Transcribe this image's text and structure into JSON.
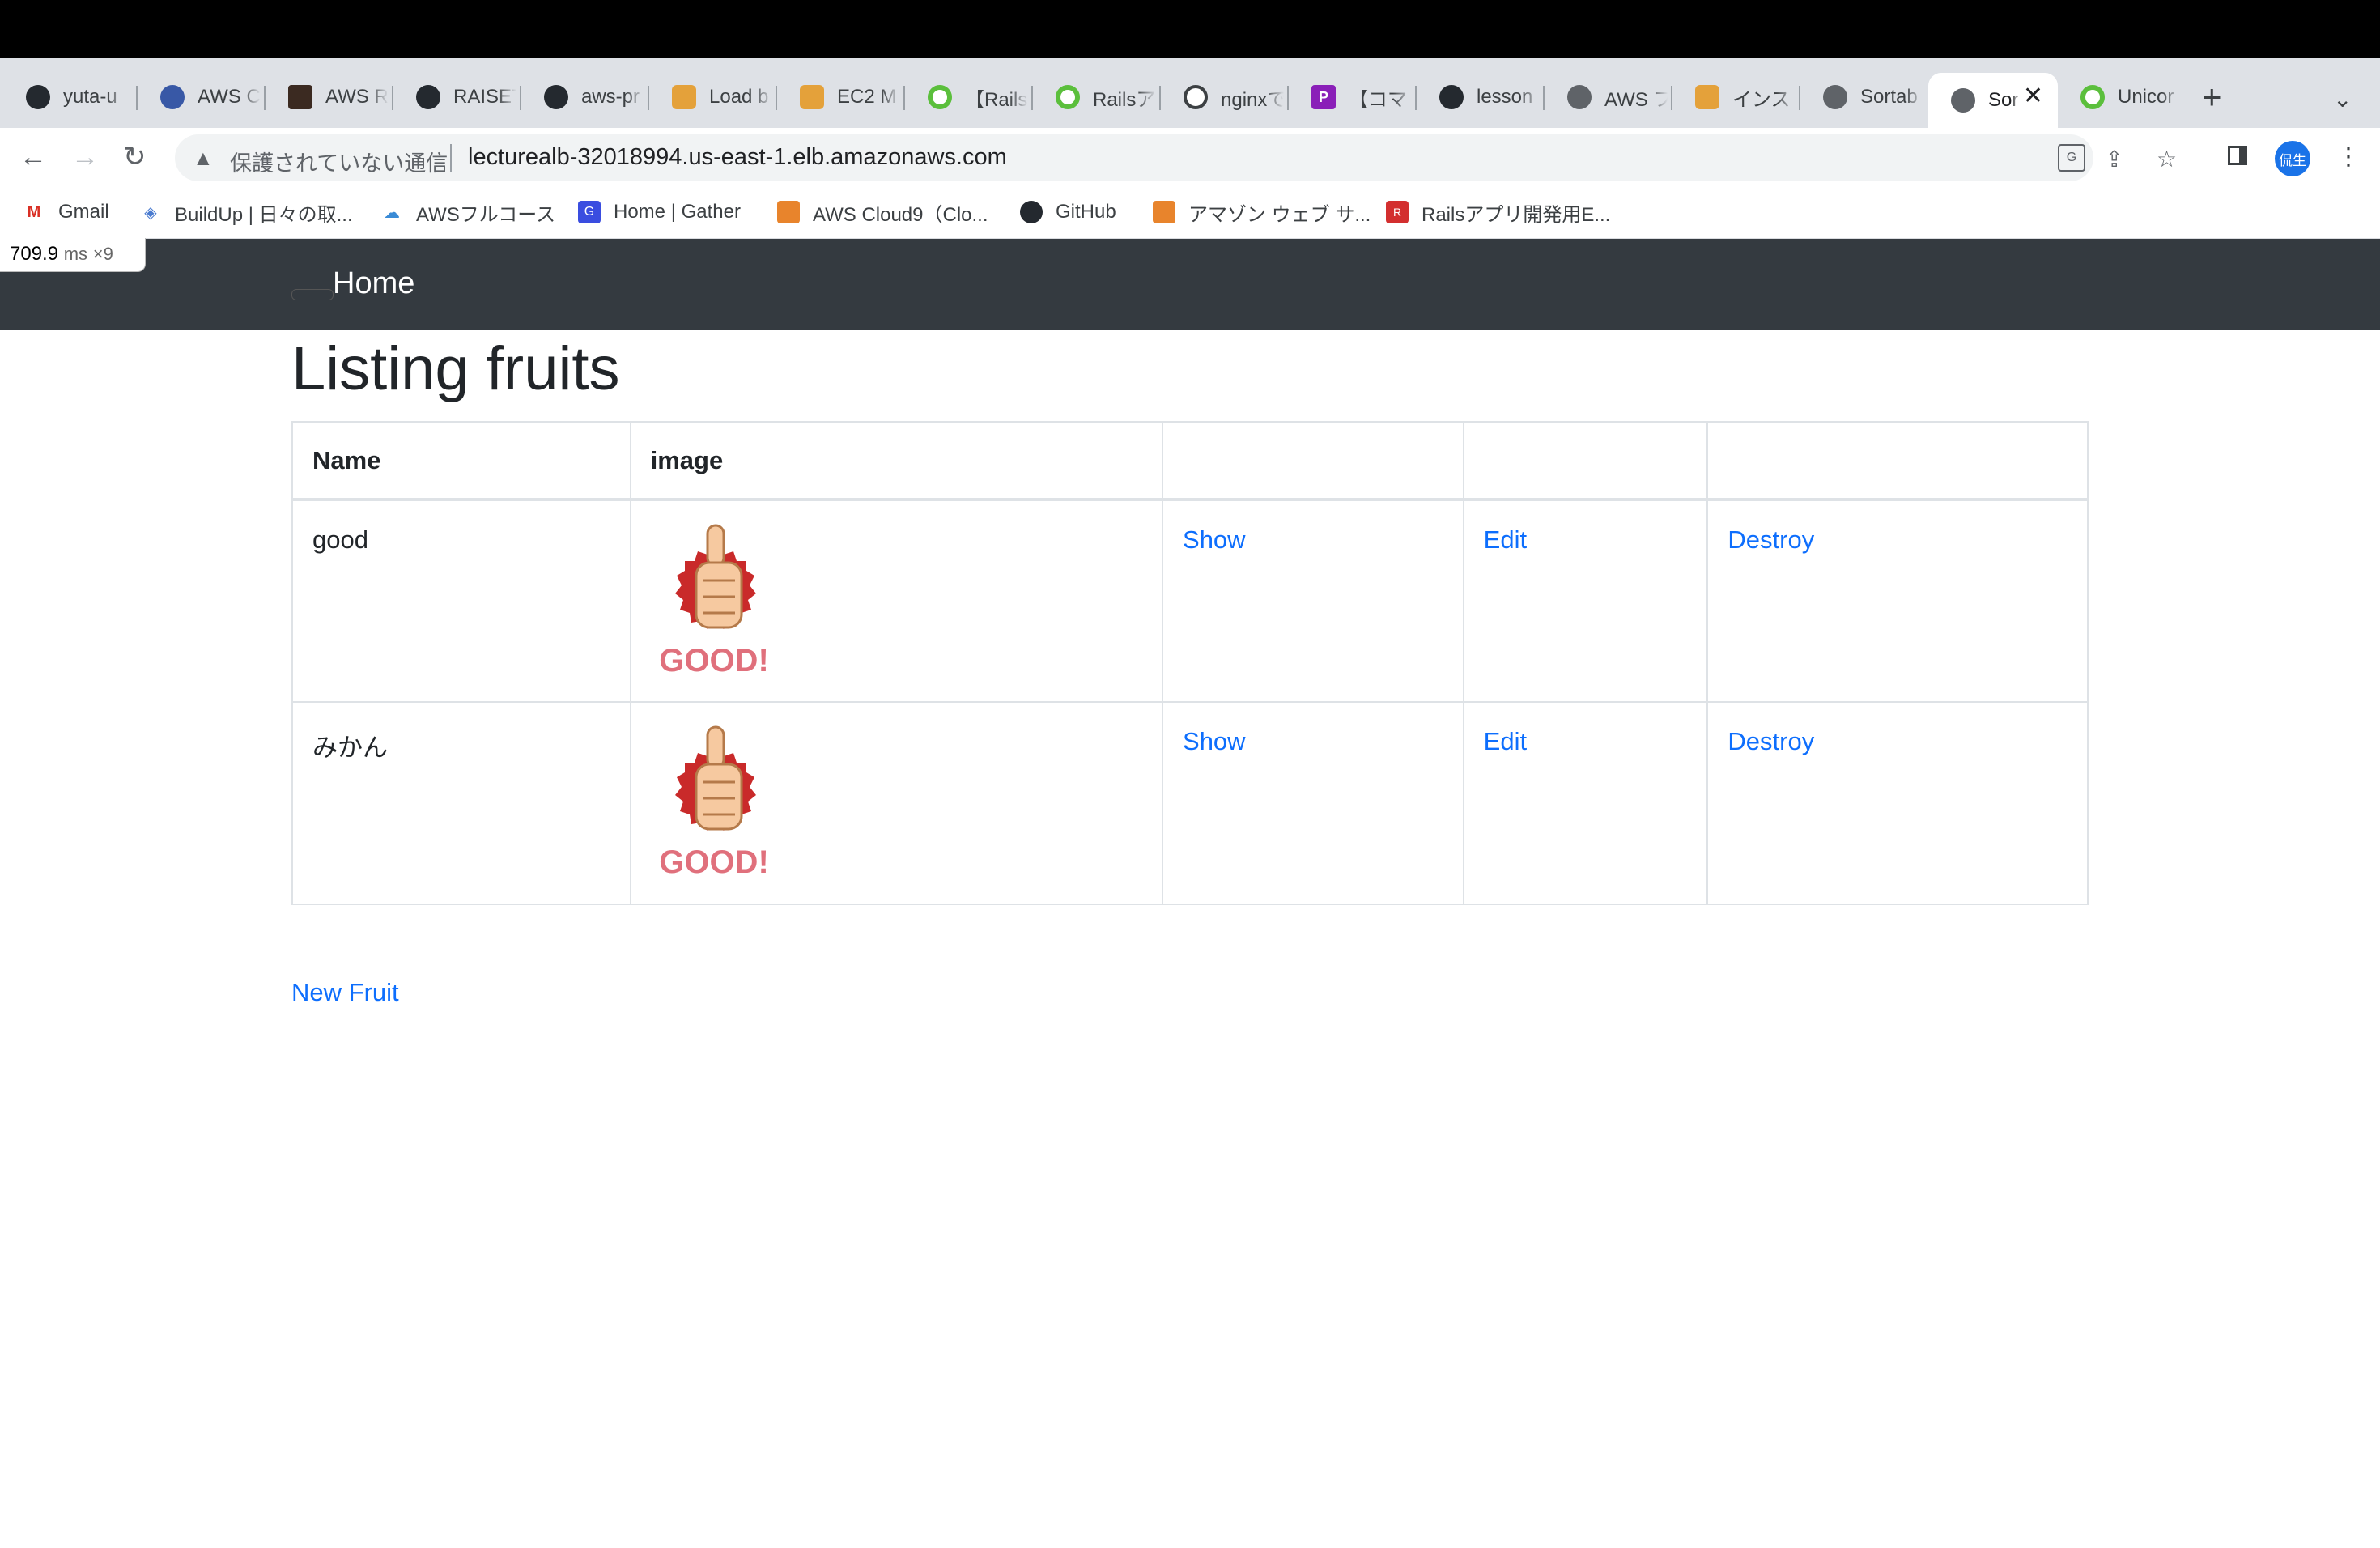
{
  "browser": {
    "tabs": [
      {
        "title": "yuta-u",
        "icon": "github-icon"
      },
      {
        "title": "AWS C",
        "icon": "wordpress-icon"
      },
      {
        "title": "AWS R",
        "icon": "photo-icon"
      },
      {
        "title": "RAISET",
        "icon": "github-icon"
      },
      {
        "title": "aws-pr",
        "icon": "github-icon"
      },
      {
        "title": "Load b",
        "icon": "aws-box-icon"
      },
      {
        "title": "EC2 M",
        "icon": "aws-box-icon"
      },
      {
        "title": "【Rails",
        "icon": "green-ring-icon"
      },
      {
        "title": "Railsア",
        "icon": "green-ring-icon"
      },
      {
        "title": "nginxで",
        "icon": "bulb-icon"
      },
      {
        "title": "【コマ",
        "icon": "p-logo-icon"
      },
      {
        "title": "lesson",
        "icon": "github-icon"
      },
      {
        "title": "AWS フ",
        "icon": "globe-icon"
      },
      {
        "title": "インス",
        "icon": "aws-box-icon"
      },
      {
        "title": "Sortab",
        "icon": "globe-icon"
      },
      {
        "title": "Sor",
        "icon": "globe-icon"
      },
      {
        "title": "Unicor",
        "icon": "green-ring-icon"
      }
    ],
    "new_tab": "+",
    "security_label": "保護されていない通信",
    "url": "lecturealb-32018994.us-east-1.elb.amazonaws.com",
    "avatar_text": "侃生",
    "bookmarks": [
      {
        "label": "Gmail",
        "icon": "gmail-icon"
      },
      {
        "label": "BuildUp | 日々の取...",
        "icon": "buildup-icon"
      },
      {
        "label": "AWSフルコース",
        "icon": "cloud-icon"
      },
      {
        "label": "Home | Gather",
        "icon": "gather-icon"
      },
      {
        "label": "AWS Cloud9（Clo...",
        "icon": "aws-box-icon"
      },
      {
        "label": "GitHub",
        "icon": "github-icon"
      },
      {
        "label": "アマゾン ウェブ サ...",
        "icon": "aws-box-icon"
      },
      {
        "label": "Railsアプリ開発用E...",
        "icon": "rails-icon"
      }
    ]
  },
  "perf": {
    "value": "709.9",
    "unit": "ms",
    "count": "×9"
  },
  "navbar": {
    "brand": "Home"
  },
  "page": {
    "title": "Listing fruits",
    "columns": [
      "Name",
      "image",
      "",
      "",
      ""
    ],
    "rows": [
      {
        "name": "good",
        "image": "GOOD!",
        "show": "Show",
        "edit": "Edit",
        "destroy": "Destroy"
      },
      {
        "name": "みかん",
        "image": "GOOD!",
        "show": "Show",
        "edit": "Edit",
        "destroy": "Destroy"
      }
    ],
    "new_link": "New Fruit"
  },
  "colors": {
    "navbar": "#343a40",
    "link": "#0d6efd",
    "badge_red": "#c92a2a"
  }
}
